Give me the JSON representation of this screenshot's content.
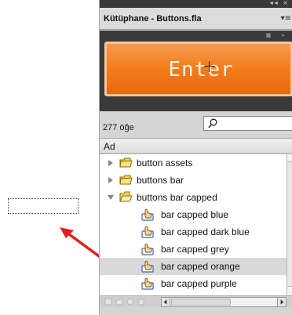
{
  "window": {
    "title": "Kütüphane - Buttons.fla",
    "top_controls": "◂◂ ×",
    "menu_glyph": "▾≡"
  },
  "preview": {
    "button_label": "Enter",
    "accent_color": "#f47f1e"
  },
  "library": {
    "item_count": "277 öğe",
    "search": {
      "value": "",
      "icon": "search-icon"
    },
    "column_header": "Ad",
    "items": [
      {
        "label": "button assets",
        "kind": "folder",
        "state": "collapsed"
      },
      {
        "label": "buttons bar",
        "kind": "folder",
        "state": "collapsed"
      },
      {
        "label": "buttons bar capped",
        "kind": "folder",
        "state": "expanded"
      },
      {
        "label": "bar capped blue",
        "kind": "button-symbol"
      },
      {
        "label": "bar capped dark blue",
        "kind": "button-symbol"
      },
      {
        "label": "bar capped grey",
        "kind": "button-symbol"
      },
      {
        "label": "bar capped orange",
        "kind": "button-symbol",
        "selected": true
      },
      {
        "label": "bar capped purple",
        "kind": "button-symbol"
      }
    ]
  },
  "annotation": {
    "arrow_color": "#e02020"
  }
}
